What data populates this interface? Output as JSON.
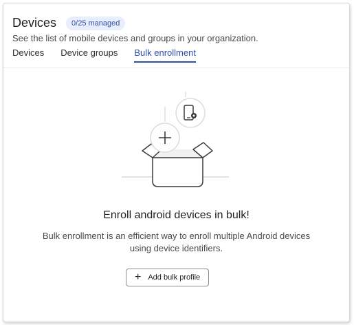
{
  "header": {
    "title": "Devices",
    "badge": "0/25 managed",
    "subtitle": "See the list of mobile devices and groups in your organization."
  },
  "tabs": [
    {
      "label": "Devices",
      "active": false
    },
    {
      "label": "Device groups",
      "active": false
    },
    {
      "label": "Bulk enrollment",
      "active": true
    }
  ],
  "empty_state": {
    "title": "Enroll android devices in bulk!",
    "description": "Bulk enrollment is an efficient way to enroll multiple Android devices using device identifiers.",
    "button_label": "Add bulk profile",
    "button_icon": "plus-icon"
  },
  "colors": {
    "accent": "#2f4fa8",
    "badge_bg": "#e8eefc"
  }
}
